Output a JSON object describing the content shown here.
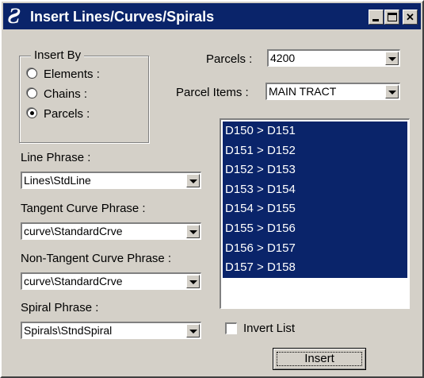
{
  "window": {
    "title": "Insert Lines/Curves/Spirals",
    "icon": "app-logo-icon"
  },
  "insert_by": {
    "legend": "Insert By",
    "options": [
      {
        "label": "Elements :",
        "checked": false
      },
      {
        "label": "Chains :",
        "checked": false
      },
      {
        "label": "Parcels :",
        "checked": true
      }
    ]
  },
  "parcels": {
    "label": "Parcels :",
    "value": "4200"
  },
  "parcel_items": {
    "label": "Parcel Items :",
    "value": "MAIN TRACT"
  },
  "line_phrase": {
    "label": "Line Phrase :",
    "value": "Lines\\StdLine"
  },
  "tangent_curve": {
    "label": "Tangent Curve Phrase :",
    "value": "curve\\StandardCrve"
  },
  "non_tangent_curve": {
    "label": "Non-Tangent Curve Phrase :",
    "value": "curve\\StandardCrve"
  },
  "spiral": {
    "label": "Spiral Phrase :",
    "value": "Spirals\\StndSpiral"
  },
  "items_list": {
    "items": [
      "D150 > D151",
      "D151 > D152",
      "D152 > D153",
      "D153 > D154",
      "D154 > D155",
      "D155 > D156",
      "D156 > D157",
      "D157 > D158"
    ],
    "selected_color": "#0a246a"
  },
  "invert_list": {
    "label": "Invert List",
    "checked": false
  },
  "insert_button": {
    "label": "Insert"
  },
  "colors": {
    "face": "#d4d0c8",
    "titlebar": "#0a246a"
  }
}
